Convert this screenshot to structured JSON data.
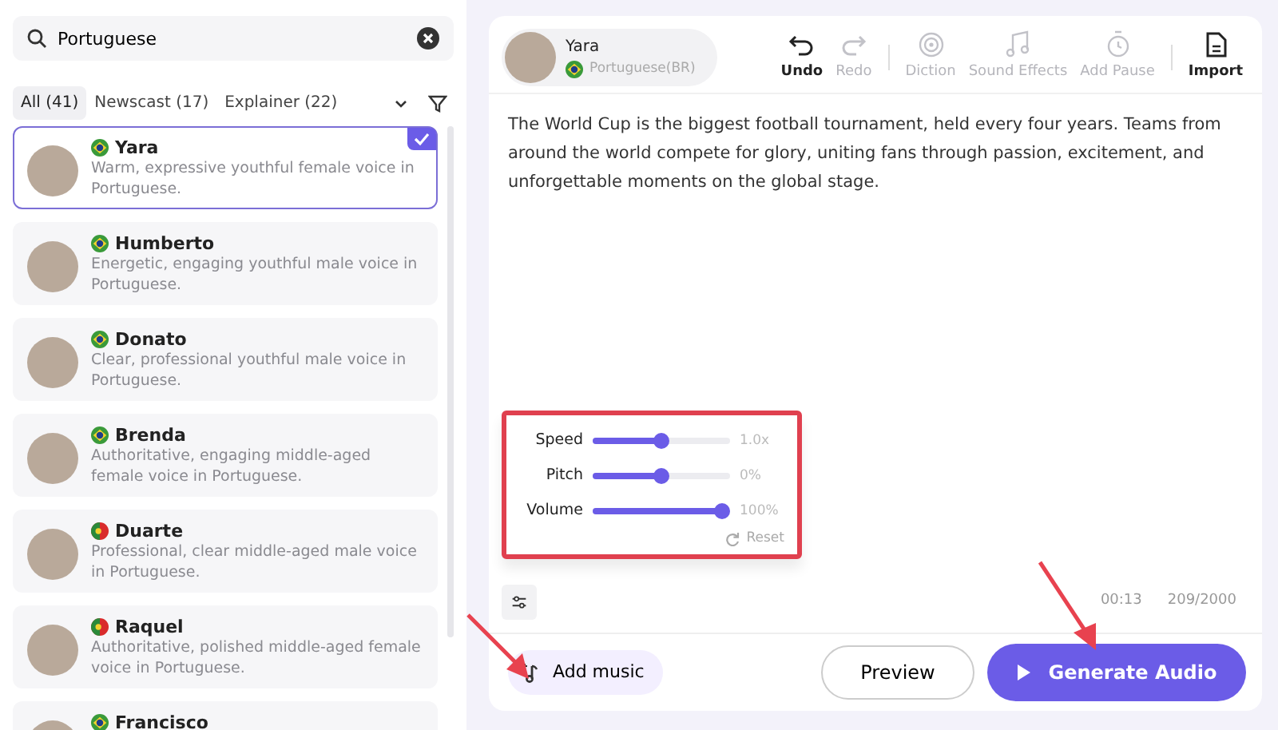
{
  "search": {
    "value": "Portuguese"
  },
  "filter_tabs": [
    {
      "label": "All (41)",
      "selected": true
    },
    {
      "label": "Newscast (17)",
      "selected": false
    },
    {
      "label": "Explainer (22)",
      "selected": false
    }
  ],
  "voices": [
    {
      "name": "Yara",
      "kind": "br",
      "description": "Warm, expressive youthful female voice in Portuguese.",
      "selected": true
    },
    {
      "name": "Humberto",
      "kind": "br",
      "description": "Energetic, engaging youthful male voice in Portuguese.",
      "selected": false
    },
    {
      "name": "Donato",
      "kind": "br",
      "description": "Clear, professional youthful male voice in Portuguese.",
      "selected": false
    },
    {
      "name": "Brenda",
      "kind": "br",
      "description": "Authoritative, engaging middle-aged female voice in Portuguese.",
      "selected": false
    },
    {
      "name": "Duarte",
      "kind": "pt",
      "description": "Professional, clear middle-aged male voice in Portuguese.",
      "selected": false
    },
    {
      "name": "Raquel",
      "kind": "pt",
      "description": "Authoritative, polished middle-aged female voice in Portuguese.",
      "selected": false
    },
    {
      "name": "Francisco",
      "kind": "br",
      "selected": false
    }
  ],
  "current_voice": {
    "name": "Yara",
    "kind": "br",
    "language": "Portuguese(BR)"
  },
  "toolbar": [
    {
      "kind": "undo",
      "label": "Undo",
      "disabled": false
    },
    {
      "kind": "redo",
      "label": "Redo",
      "disabled": true
    },
    {
      "kind": "sep"
    },
    {
      "kind": "diction",
      "label": "Diction",
      "disabled": true
    },
    {
      "kind": "sound",
      "label": "Sound Effects",
      "disabled": true
    },
    {
      "kind": "pause",
      "label": "Add Pause",
      "disabled": true
    },
    {
      "kind": "sep"
    },
    {
      "kind": "import",
      "label": "Import",
      "disabled": false
    }
  ],
  "script_text": "The World Cup is the biggest football tournament, held every four years. Teams from around the world compete for glory, uniting fans through passion, excitement, and unforgettable moments on the global stage.",
  "sliders": [
    {
      "label": "Speed",
      "level": 0.5,
      "reading": "1.0x"
    },
    {
      "label": "Pitch",
      "level": 0.5,
      "reading": "0%"
    },
    {
      "label": "Volume",
      "level": 1,
      "reading": "100%"
    }
  ],
  "reset_label": "Reset",
  "duration": "00:13",
  "char_count": "209/2000",
  "add_music_label": "Add music",
  "preview_label": "Preview",
  "generate_label": "Generate Audio"
}
